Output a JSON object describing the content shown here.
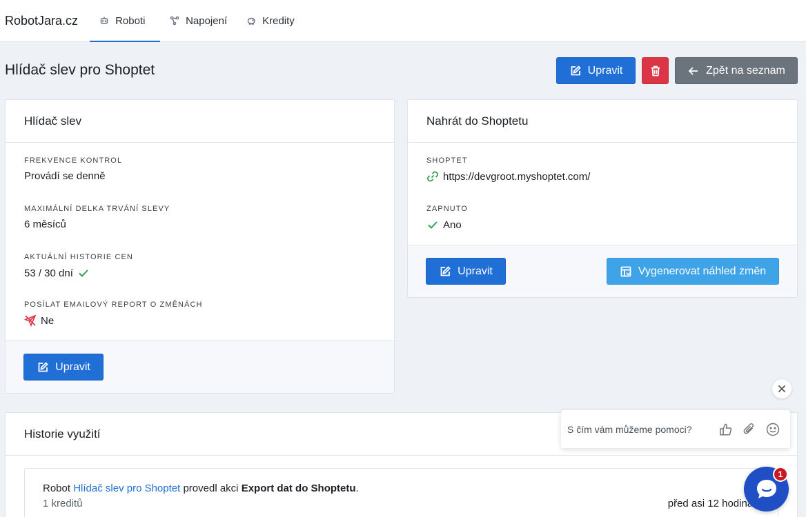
{
  "nav": {
    "brand": "RobotJara.cz",
    "tabs": [
      {
        "label": "Roboti",
        "icon": "robot-icon",
        "active": true
      },
      {
        "label": "Napojení",
        "icon": "connection-icon",
        "active": false
      },
      {
        "label": "Kredity",
        "icon": "piggy-bank-icon",
        "active": false
      }
    ]
  },
  "header": {
    "title": "Hlídač slev pro Shoptet",
    "edit_label": "Upravit",
    "back_label": "Zpět na seznam"
  },
  "card_left": {
    "title": "Hlídač slev",
    "fields": [
      {
        "label": "Frekvence kontrol",
        "value": "Provádí se denně"
      },
      {
        "label": "Maximální delka trvání slevy",
        "value": "6 měsíců"
      },
      {
        "label": "Aktuální historie cen",
        "value": "53 / 30 dní"
      },
      {
        "label": "Posílat emailový report o změnách",
        "value": "Ne"
      }
    ],
    "edit_label": "Upravit"
  },
  "card_right": {
    "title": "Nahrát do Shoptetu",
    "fields": [
      {
        "label": "Shoptet",
        "value": "https://devgroot.myshoptet.com/"
      },
      {
        "label": "Zapnuto",
        "value": "Ano"
      }
    ],
    "edit_label": "Upravit",
    "preview_label": "Vygenerovat náhled změn"
  },
  "history": {
    "title": "Historie využití",
    "item": {
      "prefix": "Robot",
      "robot_link": "Hlídač slev pro Shoptet",
      "middle": "provedl akci",
      "action": "Export dat do Shoptetu",
      "suffix": ".",
      "credits": "1 kreditů",
      "time": "před asi 12 hodinami"
    }
  },
  "chat": {
    "placeholder": "S čím vám můžeme pomoci?",
    "badge": "1"
  },
  "colors": {
    "primary": "#1f6fd6",
    "danger": "#dc3545",
    "secondary": "#6b737c",
    "info": "#3fa3e8",
    "success": "#2e9e4f",
    "chat": "#1f4ec5"
  }
}
